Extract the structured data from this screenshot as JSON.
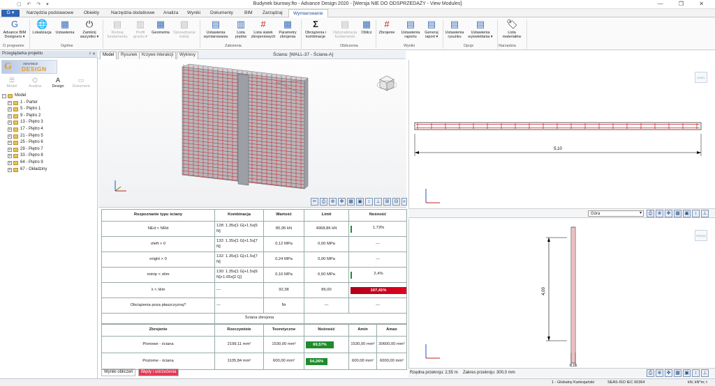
{
  "app": {
    "title": "Budynek biurowy.fto - Advance Design 2020 - [Wersja NIE DO ODSPRZEDAŻY - View Modules]",
    "quick_access": "▢ ↶ ↷ ▾",
    "window_controls": "— ❐ ✕",
    "file_button": "G ▾"
  },
  "menu_tabs": [
    "Narzędzia podstawowe",
    "Obiekty",
    "Narzędzia dodatkowe",
    "Analiza",
    "Wyniki",
    "Dokumenty",
    "BIM",
    "Zarządzaj",
    "Wymiarowanie"
  ],
  "ribbon": {
    "buttons": [
      {
        "label": "Advance BIM Designers ▾",
        "icon": "G",
        "disabled": false
      },
      {
        "label": "Lokalizacja",
        "icon": "🌐",
        "disabled": false
      },
      {
        "label": "Ustawienia",
        "icon": "▦",
        "disabled": false
      },
      {
        "label": "Zamknij wszystko ▾",
        "icon": "⏻",
        "disabled": false
      },
      {
        "label": "Rodzaj fundamentu",
        "icon": "▤",
        "disabled": true
      },
      {
        "label": "Profil gruntu ▾",
        "icon": "▥",
        "disabled": true
      },
      {
        "label": "Geometria",
        "icon": "▦",
        "disabled": false
      },
      {
        "label": "Sprawdzanie kolizji",
        "icon": "▧",
        "disabled": true
      },
      {
        "label": "Ustawienia wymiarowania",
        "icon": "▤",
        "disabled": false
      },
      {
        "label": "Lista prętów",
        "icon": "▥",
        "disabled": false
      },
      {
        "label": "Lista siatek zbrojeniowych",
        "icon": "#",
        "disabled": false
      },
      {
        "label": "Parametry zbrojenia",
        "icon": "▦",
        "disabled": false
      },
      {
        "label": "Obciążenia i kombinacje",
        "icon": "Σ",
        "disabled": false
      },
      {
        "label": "Optymalizacja fundamentu",
        "icon": "▤",
        "disabled": true
      },
      {
        "label": "Oblicz",
        "icon": "▦",
        "disabled": false
      },
      {
        "label": "Zbrojenie",
        "icon": "#",
        "disabled": false
      },
      {
        "label": "Ustawienia raportu",
        "icon": "▤",
        "disabled": false
      },
      {
        "label": "Generuj raport ▾",
        "icon": "▤",
        "disabled": false
      },
      {
        "label": "Ustawienia rysunku",
        "icon": "▤",
        "disabled": false
      },
      {
        "label": "Ustawienia wyświetlania ▾",
        "icon": "▤",
        "disabled": false
      },
      {
        "label": "Lista materiałów",
        "icon": "🏷",
        "disabled": false
      }
    ],
    "groups": [
      "O programie",
      "Ogólne",
      "Założenia",
      "Obliczenia",
      "Wyniki",
      "Opcje",
      "Narzędzia"
    ]
  },
  "project_browser": {
    "title": "Przeglądarka projektu",
    "pin": "ᵖ ✕",
    "logo": {
      "mark": "G",
      "line1": "ADVANCE",
      "line2": "DESIGN"
    },
    "modes": [
      {
        "label": "Model",
        "icon": "☰"
      },
      {
        "label": "Analiza",
        "icon": "⌬"
      },
      {
        "label": "Design",
        "icon": "A"
      },
      {
        "label": "Dokument",
        "icon": "▭"
      }
    ],
    "active_mode": "Design",
    "tree_root": "Model",
    "tree_items": [
      "1 - Parter",
      "5 - Piętro 1",
      "9 - Piętro 2",
      "13 - Piętro 3",
      "17 - Piętro 4",
      "21 - Piętro 5",
      "25 - Piętro 6",
      "29 - Piętro 7",
      "33 - Piętro 8",
      "64 - Piętro 9",
      "67 - Okładziny"
    ]
  },
  "view_tabs": [
    "Model",
    "Rysunek",
    "Krzywe interakcji",
    "Wykresy"
  ],
  "wall_header": "Ściana: [WALL-37 - Ściana-A]",
  "check_table": {
    "headers": [
      "Rozpoznanie typu ściany",
      "Kombinacja",
      "Wartość",
      "Limit",
      "Nośność"
    ],
    "rows": [
      {
        "check": "NEd < NRd",
        "combo": "128: 1.35x[1 G]+1.5x[6 N]",
        "value": "85,95 kN",
        "limit": "4968,86 kN",
        "ratio": "1,73%",
        "style": "tick"
      },
      {
        "check": "σleft > 0",
        "combo": "132: 1.35x[1 G]+1.5x[7 N]",
        "value": "0,12 MPa",
        "limit": "0,00 MPa",
        "ratio": "---",
        "style": "none"
      },
      {
        "check": "σright > 0",
        "combo": "132: 1.35x[1 G]+1.5x[7 N]",
        "value": "0,24 MPa",
        "limit": "0,00 MPa",
        "ratio": "---",
        "style": "none"
      },
      {
        "check": "σstrip < σlim",
        "combo": "130: 1.35x[1 G]+1.5x[6 N]+1.05x[2 Q]",
        "value": "0,16 MPa",
        "limit": "6,50 MPa",
        "ratio": "2,4%",
        "style": "tick"
      },
      {
        "check": "λ < λlim",
        "combo": "---",
        "value": "92,38",
        "limit": "86,00",
        "ratio": "107,41%",
        "style": "red"
      },
      {
        "check": "Obciążenia poza płaszczyzną?",
        "combo": "---",
        "value": "Nr",
        "limit": "---",
        "ratio": "---",
        "style": "none"
      }
    ],
    "wall_type": "Ściana zbrojona",
    "reinf_headers": [
      "Zbrojenie",
      "Rzeczywiste",
      "Teoretyczne",
      "Nośność",
      "Amin",
      "Amax"
    ],
    "reinf_rows": [
      {
        "name": "Pionowe - ściana",
        "actual": "2199,11 mm²",
        "theor": "1530,00 mm²",
        "ratio": "69,57%",
        "ratio_value": 69.57,
        "amin": "1530,00 mm²",
        "amax": "30600,00 mm²"
      },
      {
        "name": "Poziome - ściana",
        "actual": "1105,84 mm²",
        "theor": "600,00 mm²",
        "ratio": "54,26%",
        "ratio_value": 54.26,
        "amin": "600,00 mm²",
        "amax": "6000,00 mm²"
      }
    ]
  },
  "bottom_tabs": [
    {
      "label": "Wyniki obliczeń",
      "color": "#ffffff"
    },
    {
      "label": "Błędy i ostrzeżenia",
      "color": "#e23a55"
    }
  ],
  "right_top": {
    "dimension": "5,10",
    "view_select": "Góra",
    "navcube": "LEWY"
  },
  "right_bottom": {
    "dimension": "4,00",
    "width_label": "0,15",
    "navcube": "PRZÓD",
    "section_height": "Rzędna przekroju: 2,55 m",
    "section_range": "Zakres przekroju: 300,0 mm"
  },
  "status": {
    "text": "1 - Globalny Kartezjański",
    "extra": "SEAS-ISO IEC 60364",
    "units": "kN; kN*m; t"
  },
  "colors": {
    "accent": "#2f64b5",
    "ok": "#1e8b2d",
    "fail": "#d0001c",
    "rebar": "#d0262b"
  }
}
